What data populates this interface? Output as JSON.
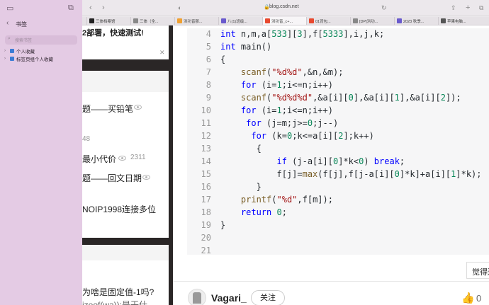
{
  "sidebar": {
    "title": "书签",
    "search_placeholder": "搜索书签",
    "items": [
      {
        "label": "个人收藏",
        "color": "#3a7bd5"
      },
      {
        "label": "标签页组个人收藏",
        "color": "#3a7bd5"
      }
    ]
  },
  "browser": {
    "address": "blog.csdn.net",
    "tabs": [
      {
        "label": "三体档案馆",
        "color": "#222222"
      },
      {
        "label": "三体（全...",
        "color": "#888888"
      },
      {
        "label": "洪功音那...",
        "color": "#f0a030"
      },
      {
        "label": "八(1)班级...",
        "color": "#6a5acd"
      },
      {
        "label": "洪功音_c+...",
        "color": "#e8492f"
      },
      {
        "label": "01背包...",
        "color": "#e8492f"
      },
      {
        "label": "[DP]洪功...",
        "color": "#888888"
      },
      {
        "label": "2023 秋季...",
        "color": "#6a5acd"
      },
      {
        "label": "苹果电脑...",
        "color": "#555555"
      }
    ]
  },
  "article": {
    "banner": "2部署，快速测试!",
    "links": [
      {
        "text": "题——买铅笔"
      },
      {
        "text": "48"
      },
      {
        "text": "最小代价",
        "views": "2311"
      },
      {
        "text": "题——回文日期"
      },
      {
        "text": "NOIP1998连接多位"
      }
    ],
    "bottom_lines": [
      "为啥是固定值-1吗?",
      "izeof(wa)):是干什"
    ]
  },
  "code": {
    "line_numbers": [
      "4",
      "5",
      "6",
      "7",
      "8",
      "9",
      "10",
      "11",
      "12",
      "13",
      "14",
      "15",
      "16",
      "17",
      "18",
      "19",
      "20",
      "21"
    ]
  },
  "footer": {
    "tooltip": "觉得还",
    "author": "Vagari_",
    "follow_label": "关注",
    "like_count": "0"
  }
}
